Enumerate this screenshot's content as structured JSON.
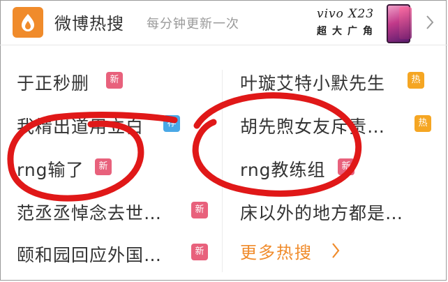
{
  "header": {
    "title": "微博热搜",
    "subtitle": "每分钟更新一次",
    "logo_icon": "weibo-flame-icon",
    "ad_brand": "vivo X23",
    "ad_slogan": "超大广角"
  },
  "hot_items": [
    {
      "label": "于正秒删",
      "badge": "新"
    },
    {
      "label": "叶璇艾特小默先生",
      "badge": "热"
    },
    {
      "label": "我精出道用立白",
      "badge": "荐"
    },
    {
      "label": "胡先煦女友斥责…",
      "badge": "热"
    },
    {
      "label": "rng输了",
      "badge": "新"
    },
    {
      "label": "rng教练组",
      "badge": "新"
    },
    {
      "label": "范丞丞悼念去世…",
      "badge": "新"
    },
    {
      "label": "床以外的地方都是…",
      "badge": ""
    },
    {
      "label": "颐和园回应外国…",
      "badge": "新"
    }
  ],
  "more_link": "更多热搜",
  "colors": {
    "accent": "#f08b2b",
    "badge_new": "#e8617c",
    "badge_hot": "#f5a623",
    "badge_rec": "#4aa8e6",
    "annotation": "#e01818"
  }
}
